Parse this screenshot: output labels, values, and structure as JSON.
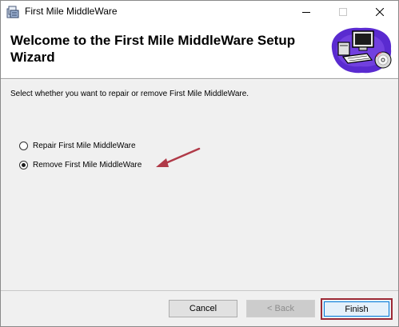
{
  "window": {
    "title": "First Mile MiddleWare",
    "icons": {
      "app": "installer-package-icon",
      "minimize": "minimize-icon",
      "maximize": "maximize-icon",
      "close": "close-icon"
    }
  },
  "banner": {
    "title": "Welcome to the First Mile MiddleWare Setup Wizard",
    "art": "computer-setup-illustration"
  },
  "instruction": "Select whether you want to repair or remove First Mile MiddleWare.",
  "options": [
    {
      "label": "Repair First Mile MiddleWare",
      "selected": false
    },
    {
      "label": "Remove First Mile MiddleWare",
      "selected": true
    }
  ],
  "annotation": {
    "color": "#b03a48",
    "icon": "red-arrow-icon"
  },
  "buttons": {
    "cancel": "Cancel",
    "back": "< Back",
    "finish": "Finish"
  },
  "colors": {
    "highlight_border": "#9d2a35",
    "focus_blue": "#0078d7",
    "banner_bg": "#ffffff",
    "body_bg": "#f0f0f0"
  }
}
